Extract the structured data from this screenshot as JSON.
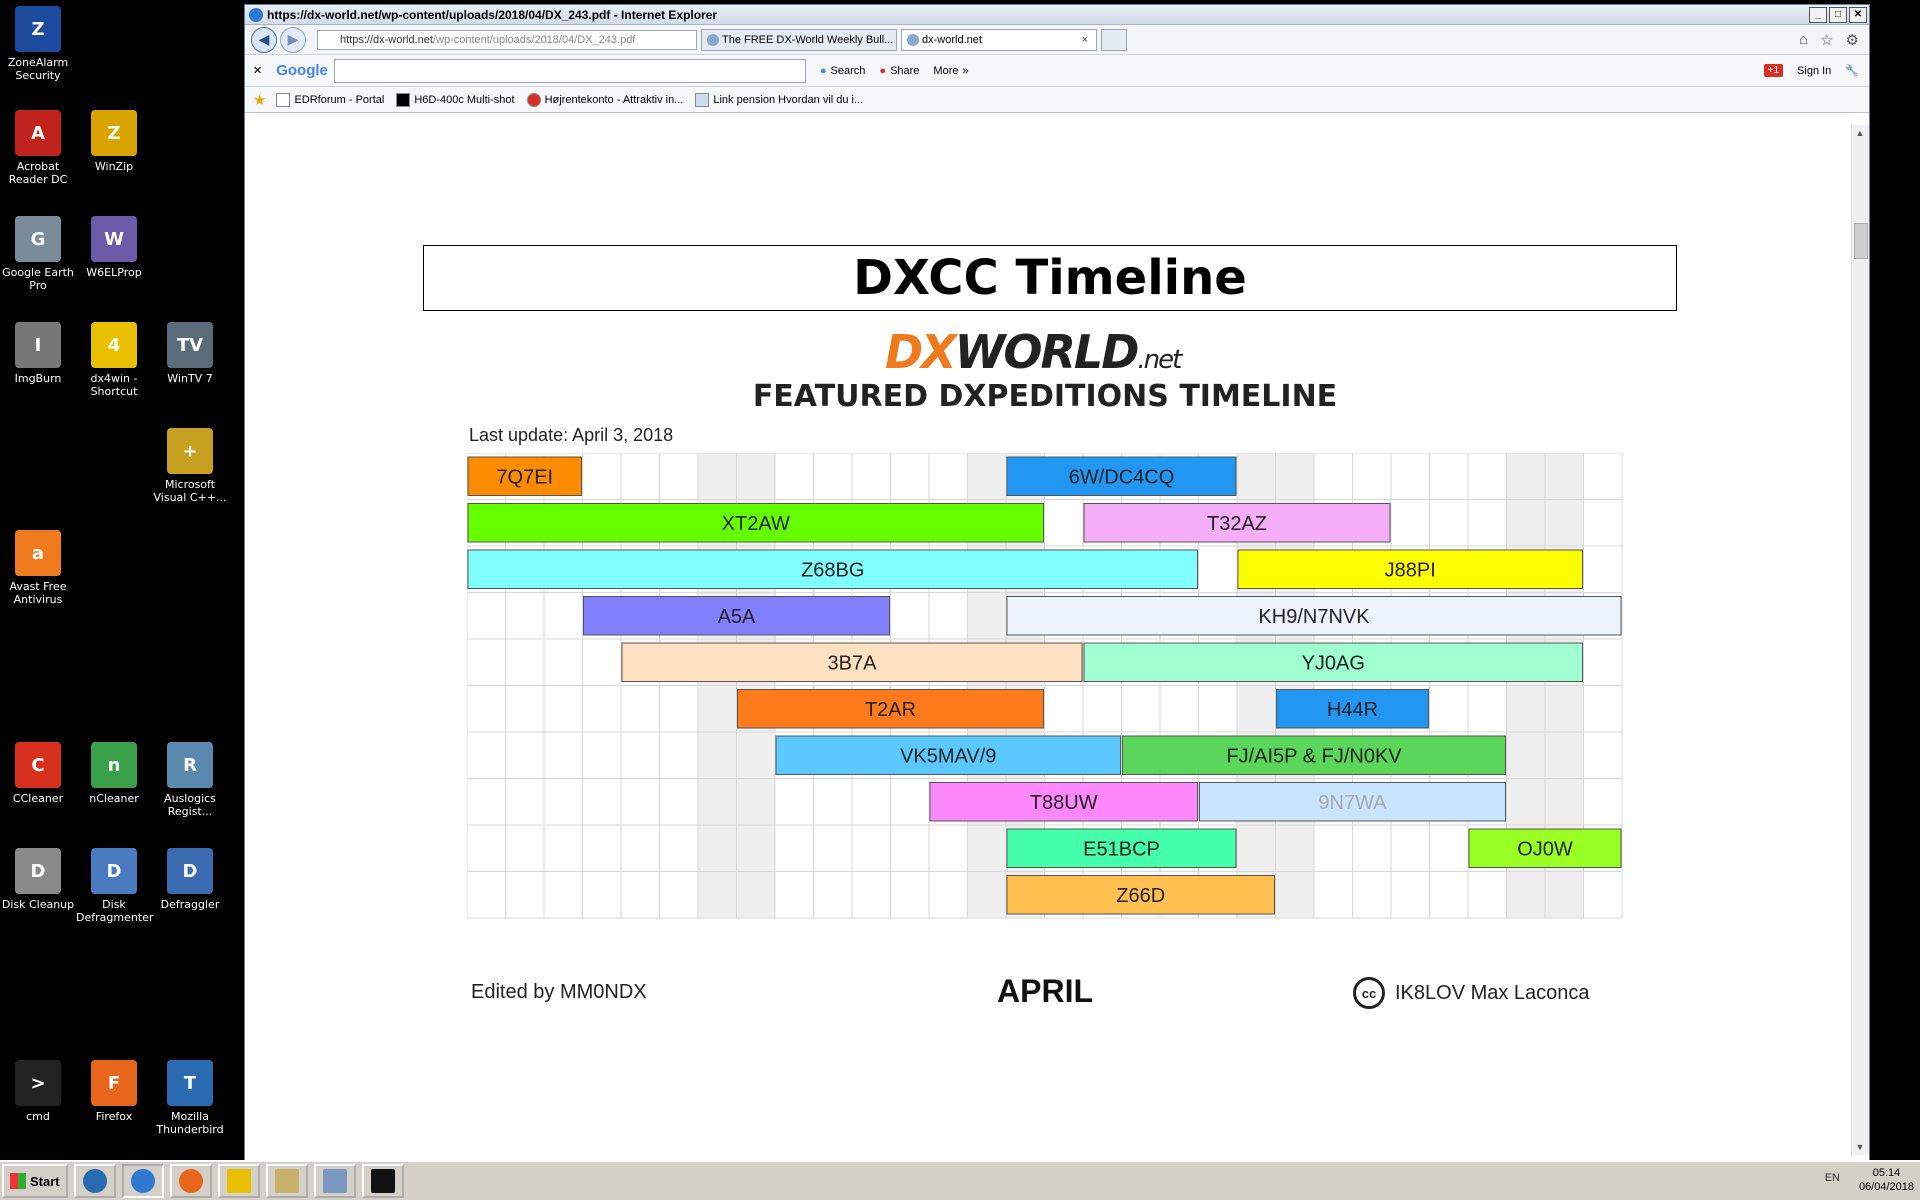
{
  "desktop": {
    "icons": [
      {
        "label": "ZoneAlarm Security",
        "glyph": "Z",
        "color": "#1c4a9c"
      },
      {
        "label": "Acrobat Reader DC",
        "glyph": "A",
        "color": "#c0221c"
      },
      {
        "label": "WinZip",
        "glyph": "Z",
        "color": "#d9a400"
      },
      {
        "label": "Google Earth Pro",
        "glyph": "G",
        "color": "#7a8b9a"
      },
      {
        "label": "W6ELProp",
        "glyph": "W",
        "color": "#6a5aa8"
      },
      {
        "label": "ImgBurn",
        "glyph": "I",
        "color": "#777777"
      },
      {
        "label": "dx4win - Shortcut",
        "glyph": "4",
        "color": "#e8c000"
      },
      {
        "label": "WinTV 7",
        "glyph": "TV",
        "color": "#5a6b7a"
      },
      {
        "label": "Microsoft Visual C++...",
        "glyph": "+",
        "color": "#c8a020"
      },
      {
        "label": "Avast Free Antivirus",
        "glyph": "a",
        "color": "#f07a1e"
      },
      {
        "label": "CCleaner",
        "glyph": "C",
        "color": "#d8301c"
      },
      {
        "label": "nCleaner",
        "glyph": "n",
        "color": "#3aa04a"
      },
      {
        "label": "Auslogics Regist...",
        "glyph": "R",
        "color": "#5a8ab0"
      },
      {
        "label": "Disk Cleanup",
        "glyph": "D",
        "color": "#8a8a8a"
      },
      {
        "label": "Disk Defragmenter",
        "glyph": "D",
        "color": "#4a7ac0"
      },
      {
        "label": "Defraggler",
        "glyph": "D",
        "color": "#3a6ab0"
      },
      {
        "label": "cmd",
        "glyph": ">",
        "color": "#222222"
      },
      {
        "label": "Firefox",
        "glyph": "F",
        "color": "#e8661c"
      },
      {
        "label": "Mozilla Thunderbird",
        "glyph": "T",
        "color": "#2a6ab0"
      }
    ]
  },
  "browser": {
    "window_title": "https://dx-world.net/wp-content/uploads/2018/04/DX_243.pdf - Internet Explorer",
    "address_domain": "https://dx-world.net",
    "address_path": "/wp-content/uploads/2018/04/DX_243.pdf",
    "tabs": [
      {
        "label": "The FREE DX-World Weekly Bull..."
      },
      {
        "label": "dx-world.net"
      }
    ],
    "tab_close": "×",
    "google_logo": "Google",
    "google_buttons": {
      "search": "Search",
      "share": "Share",
      "more": "More"
    },
    "google_sign_in": "Sign In",
    "google_plus": "+1",
    "favorites": [
      {
        "label": "EDRforum - Portal"
      },
      {
        "label": "H6D-400c Multi-shot"
      },
      {
        "label": "Højrentekonto - Attraktiv in..."
      },
      {
        "label": "Link pension Hvordan vil du i..."
      }
    ]
  },
  "document": {
    "title": "DXCC Timeline",
    "logo_dx": "DX",
    "logo_world": "WORLD",
    "logo_net": ".net",
    "subtitle": "FEATURED DXPEDITIONS TIMELINE",
    "last_update": "Last update: April 3, 2018",
    "footer_left": "Edited by MM0NDX",
    "footer_month": "APRIL",
    "footer_cc": "cc",
    "footer_right": "IK8LOV Max Laconca"
  },
  "chart_data": {
    "type": "gantt",
    "x_label": "APRIL",
    "x_range": [
      1,
      30
    ],
    "weekend_days": [
      7,
      8,
      14,
      15,
      21,
      22,
      28,
      29
    ],
    "rows": 10,
    "bars": [
      {
        "label": "7Q7EI",
        "start": 1,
        "end": 3,
        "row": 0,
        "color": "#ff8c00"
      },
      {
        "label": "6W/DC4CQ",
        "start": 15,
        "end": 20,
        "row": 0,
        "color": "#2196f3"
      },
      {
        "label": "XT2AW",
        "start": 1,
        "end": 15,
        "row": 1,
        "color": "#66ff00"
      },
      {
        "label": "T32AZ",
        "start": 17,
        "end": 24,
        "row": 1,
        "color": "#f7aef8"
      },
      {
        "label": "Z68BG",
        "start": 1,
        "end": 19,
        "row": 2,
        "color": "#80ffff"
      },
      {
        "label": "J88PI",
        "start": 21,
        "end": 29,
        "row": 2,
        "color": "#ffff00"
      },
      {
        "label": "A5A",
        "start": 4,
        "end": 11,
        "row": 3,
        "color": "#8080ff"
      },
      {
        "label": "KH9/N7NVK",
        "start": 15,
        "end": 30,
        "row": 3,
        "color": "#eef4ff"
      },
      {
        "label": "3B7A",
        "start": 5,
        "end": 16,
        "row": 4,
        "color": "#ffe0c0"
      },
      {
        "label": "YJ0AG",
        "start": 17,
        "end": 29,
        "row": 4,
        "color": "#a0ffd0"
      },
      {
        "label": "T2AR",
        "start": 8,
        "end": 15,
        "row": 5,
        "color": "#ff7a1a"
      },
      {
        "label": "H44R",
        "start": 22,
        "end": 25,
        "row": 5,
        "color": "#2196f3"
      },
      {
        "label": "VK5MAV/9",
        "start": 9,
        "end": 17,
        "row": 6,
        "color": "#5bc8ff"
      },
      {
        "label": "FJ/AI5P & FJ/N0KV",
        "start": 18,
        "end": 27,
        "row": 6,
        "color": "#5ad65a"
      },
      {
        "label": "T88UW",
        "start": 13,
        "end": 19,
        "row": 7,
        "color": "#ff88ff"
      },
      {
        "label": "9N7WA",
        "start": 20,
        "end": 27,
        "row": 7,
        "color": "#c8e4ff",
        "text_color": "#aaaaaa"
      },
      {
        "label": "E51BCP",
        "start": 15,
        "end": 20,
        "row": 8,
        "color": "#44ffaa"
      },
      {
        "label": "OJ0W",
        "start": 27,
        "end": 30,
        "row": 8,
        "color": "#99ff22"
      },
      {
        "label": "Z66D",
        "start": 15,
        "end": 21,
        "row": 9,
        "color": "#ffc050"
      }
    ]
  },
  "taskbar": {
    "start_label": "Start",
    "tray_lang": "EN",
    "clock_time": "05:14",
    "clock_date": "06/04/2018"
  }
}
